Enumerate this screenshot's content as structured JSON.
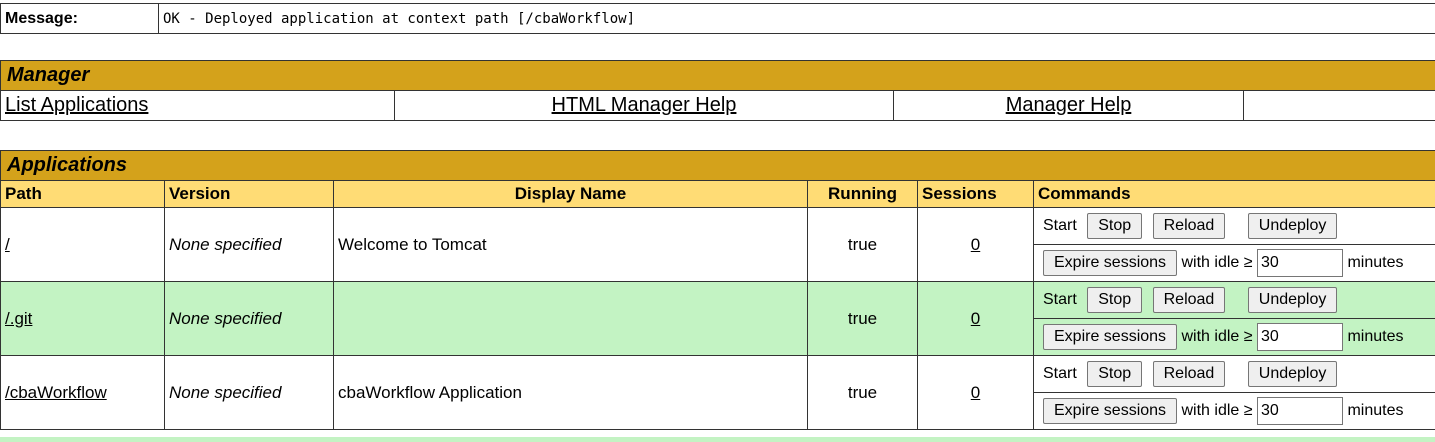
{
  "message": {
    "label": "Message:",
    "text": "OK - Deployed application at context path [/cbaWorkflow]"
  },
  "manager": {
    "title": "Manager",
    "links": [
      "List Applications",
      "HTML Manager Help",
      "Manager Help"
    ]
  },
  "applications": {
    "title": "Applications",
    "columns": [
      "Path",
      "Version",
      "Display Name",
      "Running",
      "Sessions",
      "Commands"
    ],
    "rows": [
      {
        "path": "/",
        "version": "None specified",
        "display_name": "Welcome to Tomcat",
        "running": "true",
        "sessions": "0"
      },
      {
        "path": "/.git",
        "version": "None specified",
        "display_name": "",
        "running": "true",
        "sessions": "0"
      },
      {
        "path": "/cbaWorkflow",
        "version": "None specified",
        "display_name": "cbaWorkflow Application",
        "running": "true",
        "sessions": "0"
      }
    ],
    "commands": {
      "start": "Start",
      "stop": "Stop",
      "reload": "Reload",
      "undeploy": "Undeploy",
      "expire": "Expire sessions",
      "with_idle": "with idle ≥",
      "idle_value": "30",
      "minutes": "minutes"
    }
  },
  "colors": {
    "section_title_bg": "#d4a21b",
    "header_bg": "#ffdc75",
    "alt_row_bg": "#c3f3c3"
  }
}
